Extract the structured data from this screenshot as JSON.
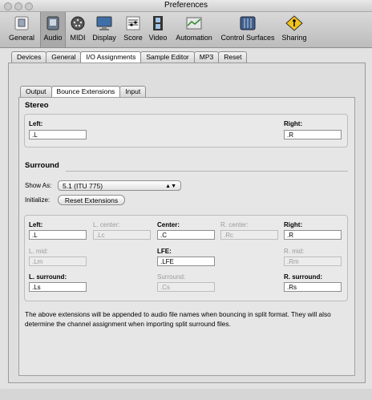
{
  "window": {
    "title": "Preferences"
  },
  "toolbar": {
    "items": [
      {
        "label": "General",
        "icon": "switch-icon"
      },
      {
        "label": "Audio",
        "icon": "audio-plug-icon"
      },
      {
        "label": "MIDI",
        "icon": "midi-plug-icon"
      },
      {
        "label": "Display",
        "icon": "monitor-icon"
      },
      {
        "label": "Score",
        "icon": "score-icon"
      },
      {
        "label": "Video",
        "icon": "film-icon"
      },
      {
        "label": "Automation",
        "icon": "automation-icon"
      },
      {
        "label": "Control Surfaces",
        "icon": "mixer-icon"
      },
      {
        "label": "Sharing",
        "icon": "sharing-icon"
      }
    ],
    "selected": "Audio"
  },
  "tabs": {
    "main": [
      "Devices",
      "General",
      "I/O Assignments",
      "Sample Editor",
      "MP3",
      "Reset"
    ],
    "main_selected": "I/O Assignments",
    "sub": [
      "Output",
      "Bounce Extensions",
      "Input"
    ],
    "sub_selected": "Bounce Extensions"
  },
  "stereo": {
    "title": "Stereo",
    "left_label": "Left:",
    "left_value": ".L",
    "right_label": "Right:",
    "right_value": ".R"
  },
  "surround": {
    "title": "Surround",
    "show_as_label": "Show As:",
    "show_as_value": "5.1 (ITU 775)",
    "initialize_label": "Initialize:",
    "reset_button": "Reset Extensions",
    "fields": {
      "left_label": "Left:",
      "left_value": ".L",
      "lcenter_label": "L. center:",
      "lcenter_value": ".Lc",
      "center_label": "Center:",
      "center_value": ".C",
      "rcenter_label": "R. center:",
      "rcenter_value": ".Rc",
      "right_label": "Right:",
      "right_value": ".R",
      "lmid_label": "L. mid:",
      "lmid_value": ".Lm",
      "lfe_label": "LFE:",
      "lfe_value": ".LFE",
      "rmid_label": "R. mid:",
      "rmid_value": ".Rm",
      "lsurround_label": "L. surround:",
      "lsurround_value": ".Ls",
      "surround_label": "Surround:",
      "surround_value": ".Cs",
      "rsurround_label": "R. surround:",
      "rsurround_value": ".Rs"
    }
  },
  "note": {
    "line1": "The above extensions will be appended to audio file names when bouncing in split format. They will also",
    "line2": "determine the channel assignment when importing split surround files."
  }
}
